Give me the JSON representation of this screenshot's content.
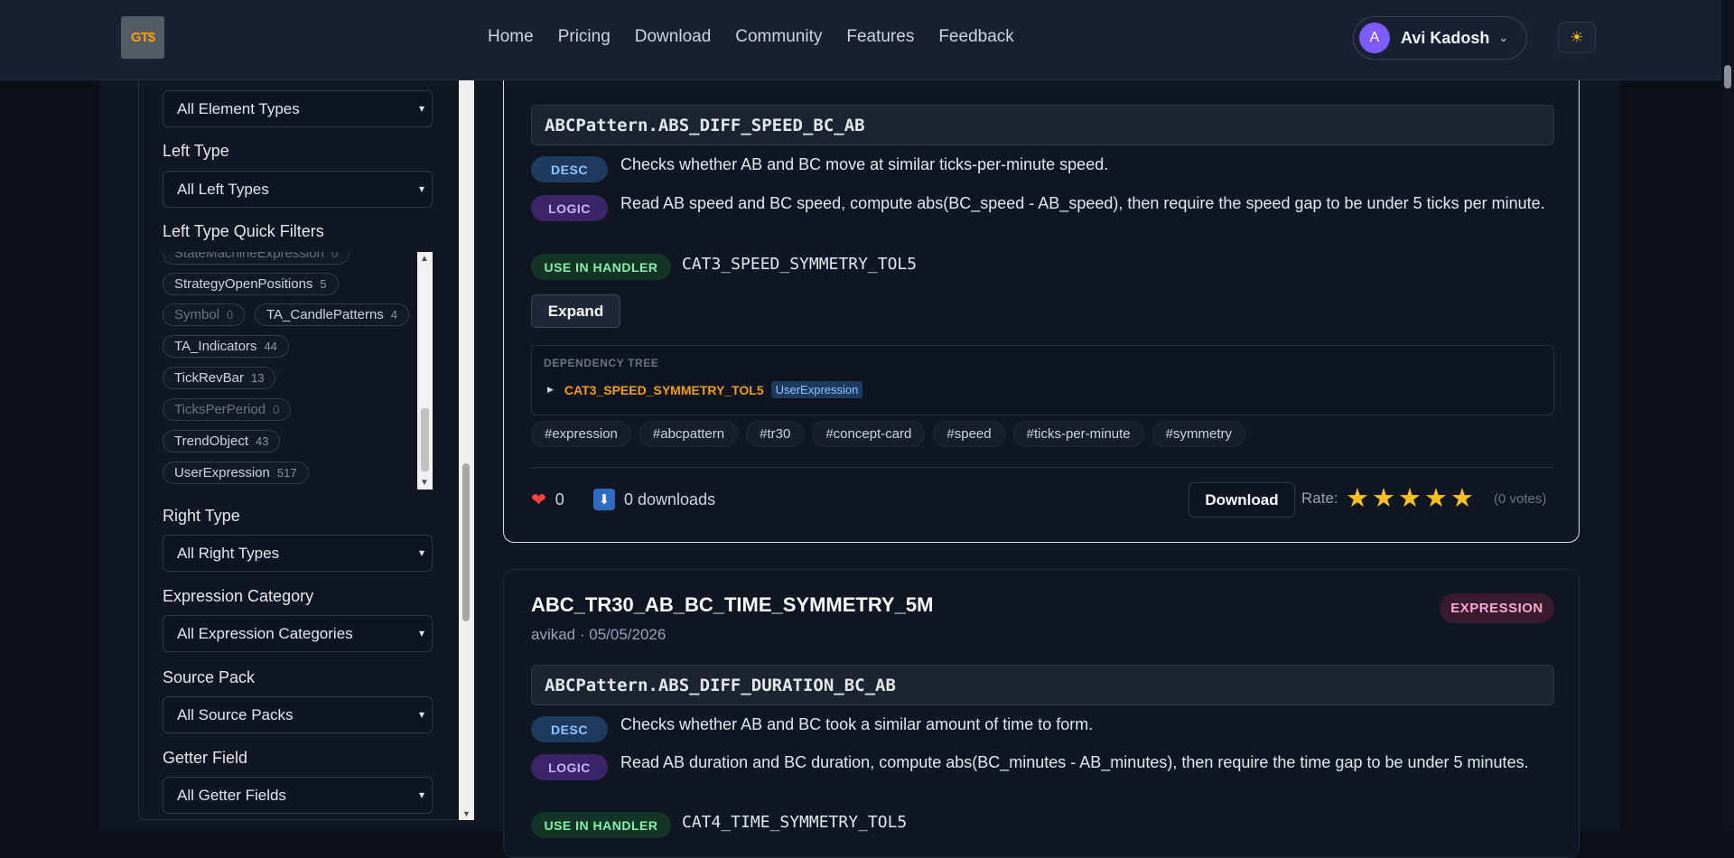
{
  "nav": {
    "logo": "GT$",
    "links": [
      "Home",
      "Pricing",
      "Download",
      "Community",
      "Features",
      "Feedback"
    ],
    "user": {
      "initial": "A",
      "name": "Avi Kadosh"
    },
    "theme_icon": "☀"
  },
  "sidebar": {
    "element_type": "All Element Types",
    "left_type_label": "Left Type",
    "left_type": "All Left Types",
    "quick_filters_label": "Left Type Quick Filters",
    "chips": [
      {
        "label": "StateMachineExpression",
        "count": "0"
      },
      {
        "label": "StrategyOpenPositions",
        "count": "5"
      },
      {
        "label": "Symbol",
        "count": "0"
      },
      {
        "label": "TA_CandlePatterns",
        "count": "4"
      },
      {
        "label": "TA_Indicators",
        "count": "44"
      },
      {
        "label": "TickRevBar",
        "count": "13"
      },
      {
        "label": "TicksPerPeriod",
        "count": "0"
      },
      {
        "label": "TrendObject",
        "count": "43"
      },
      {
        "label": "UserExpression",
        "count": "517"
      }
    ],
    "right_type_label": "Right Type",
    "right_type": "All Right Types",
    "expr_cat_label": "Expression Category",
    "expr_cat": "All Expression Categories",
    "source_pack_label": "Source Pack",
    "source_pack": "All Source Packs",
    "getter_label": "Getter Field",
    "getter": "All Getter Fields"
  },
  "card1": {
    "code": "ABCPattern.ABS_DIFF_SPEED_BC_AB",
    "desc_badge": "DESC",
    "desc": "Checks whether AB and BC move at similar ticks-per-minute speed.",
    "logic_badge": "LOGIC",
    "logic": "Read AB speed and BC speed, compute abs(BC_speed - AB_speed), then require the speed gap to be under 5 ticks per minute.",
    "use_badge": "USE IN HANDLER",
    "handler": "CAT3_SPEED_SYMMETRY_TOL5",
    "expand": "Expand",
    "dep_title": "DEPENDENCY TREE",
    "dep_name": "CAT3_SPEED_SYMMETRY_TOL5",
    "dep_type": "UserExpression",
    "tags": [
      "#expression",
      "#abcpattern",
      "#tr30",
      "#concept-card",
      "#speed",
      "#ticks-per-minute",
      "#symmetry"
    ],
    "likes": "0",
    "downloads": "0 downloads",
    "download_btn": "Download",
    "rate_label": "Rate:",
    "rating": 5,
    "votes": "(0 votes)"
  },
  "card2": {
    "title": "ABC_TR30_AB_BC_TIME_SYMMETRY_5M",
    "meta": "avikad · 05/05/2026",
    "type_badge": "EXPRESSION",
    "code": "ABCPattern.ABS_DIFF_DURATION_BC_AB",
    "desc_badge": "DESC",
    "desc": "Checks whether AB and BC took a similar amount of time to form.",
    "logic_badge": "LOGIC",
    "logic": "Read AB duration and BC duration, compute abs(BC_minutes - AB_minutes), then require the time gap to be under 5 minutes.",
    "use_badge": "USE IN HANDLER",
    "handler": "CAT4_TIME_SYMMETRY_TOL5"
  }
}
